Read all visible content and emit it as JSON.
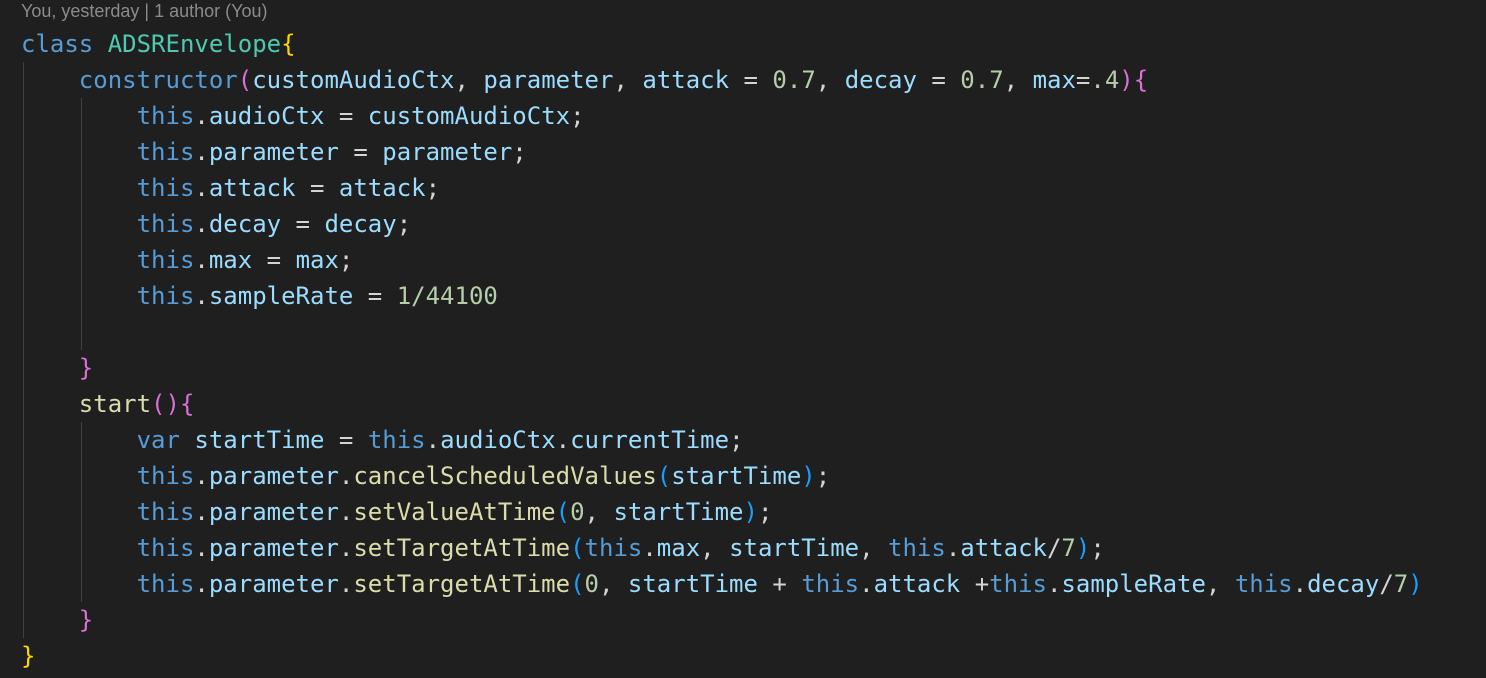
{
  "blame": {
    "text": "You, yesterday | 1 author (You)"
  },
  "lines": [
    {
      "indent": 0,
      "tokens": [
        {
          "t": "class",
          "c": "kw"
        },
        {
          "t": " ",
          "c": "op"
        },
        {
          "t": "ADSREnvelope",
          "c": "cls"
        },
        {
          "t": "{",
          "c": "b1"
        }
      ]
    },
    {
      "indent": 1,
      "tokens": [
        {
          "t": "constructor",
          "c": "kw"
        },
        {
          "t": "(",
          "c": "b2"
        },
        {
          "t": "customAudioCtx",
          "c": "prm"
        },
        {
          "t": ", ",
          "c": "op"
        },
        {
          "t": "parameter",
          "c": "prm"
        },
        {
          "t": ", ",
          "c": "op"
        },
        {
          "t": "attack",
          "c": "prm"
        },
        {
          "t": " = ",
          "c": "op"
        },
        {
          "t": "0.7",
          "c": "num"
        },
        {
          "t": ", ",
          "c": "op"
        },
        {
          "t": "decay",
          "c": "prm"
        },
        {
          "t": " = ",
          "c": "op"
        },
        {
          "t": "0.7",
          "c": "num"
        },
        {
          "t": ", ",
          "c": "op"
        },
        {
          "t": "max",
          "c": "prm"
        },
        {
          "t": "=",
          "c": "op"
        },
        {
          "t": ".4",
          "c": "num"
        },
        {
          "t": ")",
          "c": "b2"
        },
        {
          "t": "{",
          "c": "b2"
        }
      ]
    },
    {
      "indent": 2,
      "tokens": [
        {
          "t": "this",
          "c": "kw"
        },
        {
          "t": ".",
          "c": "op"
        },
        {
          "t": "audioCtx",
          "c": "prm"
        },
        {
          "t": " = ",
          "c": "op"
        },
        {
          "t": "customAudioCtx",
          "c": "prm"
        },
        {
          "t": ";",
          "c": "op"
        }
      ]
    },
    {
      "indent": 2,
      "tokens": [
        {
          "t": "this",
          "c": "kw"
        },
        {
          "t": ".",
          "c": "op"
        },
        {
          "t": "parameter",
          "c": "prm"
        },
        {
          "t": " = ",
          "c": "op"
        },
        {
          "t": "parameter",
          "c": "prm"
        },
        {
          "t": ";",
          "c": "op"
        }
      ]
    },
    {
      "indent": 2,
      "tokens": [
        {
          "t": "this",
          "c": "kw"
        },
        {
          "t": ".",
          "c": "op"
        },
        {
          "t": "attack",
          "c": "prm"
        },
        {
          "t": " = ",
          "c": "op"
        },
        {
          "t": "attack",
          "c": "prm"
        },
        {
          "t": ";",
          "c": "op"
        }
      ]
    },
    {
      "indent": 2,
      "tokens": [
        {
          "t": "this",
          "c": "kw"
        },
        {
          "t": ".",
          "c": "op"
        },
        {
          "t": "decay",
          "c": "prm"
        },
        {
          "t": " = ",
          "c": "op"
        },
        {
          "t": "decay",
          "c": "prm"
        },
        {
          "t": ";",
          "c": "op"
        }
      ]
    },
    {
      "indent": 2,
      "tokens": [
        {
          "t": "this",
          "c": "kw"
        },
        {
          "t": ".",
          "c": "op"
        },
        {
          "t": "max",
          "c": "prm"
        },
        {
          "t": " = ",
          "c": "op"
        },
        {
          "t": "max",
          "c": "prm"
        },
        {
          "t": ";",
          "c": "op"
        }
      ]
    },
    {
      "indent": 2,
      "tokens": [
        {
          "t": "this",
          "c": "kw"
        },
        {
          "t": ".",
          "c": "op"
        },
        {
          "t": "sampleRate",
          "c": "prm"
        },
        {
          "t": " = ",
          "c": "op"
        },
        {
          "t": "1/44100",
          "c": "num"
        }
      ]
    },
    {
      "indent": 0,
      "tokens": []
    },
    {
      "indent": 1,
      "tokens": [
        {
          "t": "}",
          "c": "b2"
        }
      ]
    },
    {
      "indent": 1,
      "tokens": [
        {
          "t": "start",
          "c": "fn"
        },
        {
          "t": "()",
          "c": "b2"
        },
        {
          "t": "{",
          "c": "b2"
        }
      ]
    },
    {
      "indent": 2,
      "tokens": [
        {
          "t": "var",
          "c": "kw"
        },
        {
          "t": " ",
          "c": "op"
        },
        {
          "t": "startTime",
          "c": "prm"
        },
        {
          "t": " = ",
          "c": "op"
        },
        {
          "t": "this",
          "c": "kw"
        },
        {
          "t": ".",
          "c": "op"
        },
        {
          "t": "audioCtx",
          "c": "prm"
        },
        {
          "t": ".",
          "c": "op"
        },
        {
          "t": "currentTime",
          "c": "prm"
        },
        {
          "t": ";",
          "c": "op"
        }
      ]
    },
    {
      "indent": 2,
      "tokens": [
        {
          "t": "this",
          "c": "kw"
        },
        {
          "t": ".",
          "c": "op"
        },
        {
          "t": "parameter",
          "c": "prm"
        },
        {
          "t": ".",
          "c": "op"
        },
        {
          "t": "cancelScheduledValues",
          "c": "fn"
        },
        {
          "t": "(",
          "c": "b3"
        },
        {
          "t": "startTime",
          "c": "prm"
        },
        {
          "t": ")",
          "c": "b3"
        },
        {
          "t": ";",
          "c": "op"
        }
      ]
    },
    {
      "indent": 2,
      "tokens": [
        {
          "t": "this",
          "c": "kw"
        },
        {
          "t": ".",
          "c": "op"
        },
        {
          "t": "parameter",
          "c": "prm"
        },
        {
          "t": ".",
          "c": "op"
        },
        {
          "t": "setValueAtTime",
          "c": "fn"
        },
        {
          "t": "(",
          "c": "b3"
        },
        {
          "t": "0",
          "c": "num"
        },
        {
          "t": ", ",
          "c": "op"
        },
        {
          "t": "startTime",
          "c": "prm"
        },
        {
          "t": ")",
          "c": "b3"
        },
        {
          "t": ";",
          "c": "op"
        }
      ]
    },
    {
      "indent": 2,
      "tokens": [
        {
          "t": "this",
          "c": "kw"
        },
        {
          "t": ".",
          "c": "op"
        },
        {
          "t": "parameter",
          "c": "prm"
        },
        {
          "t": ".",
          "c": "op"
        },
        {
          "t": "setTargetAtTime",
          "c": "fn"
        },
        {
          "t": "(",
          "c": "b3"
        },
        {
          "t": "this",
          "c": "kw"
        },
        {
          "t": ".",
          "c": "op"
        },
        {
          "t": "max",
          "c": "prm"
        },
        {
          "t": ", ",
          "c": "op"
        },
        {
          "t": "startTime",
          "c": "prm"
        },
        {
          "t": ", ",
          "c": "op"
        },
        {
          "t": "this",
          "c": "kw"
        },
        {
          "t": ".",
          "c": "op"
        },
        {
          "t": "attack",
          "c": "prm"
        },
        {
          "t": "/",
          "c": "op"
        },
        {
          "t": "7",
          "c": "num"
        },
        {
          "t": ")",
          "c": "b3"
        },
        {
          "t": ";",
          "c": "op"
        }
      ]
    },
    {
      "indent": 2,
      "tokens": [
        {
          "t": "this",
          "c": "kw"
        },
        {
          "t": ".",
          "c": "op"
        },
        {
          "t": "parameter",
          "c": "prm"
        },
        {
          "t": ".",
          "c": "op"
        },
        {
          "t": "setTargetAtTime",
          "c": "fn"
        },
        {
          "t": "(",
          "c": "b3"
        },
        {
          "t": "0",
          "c": "num"
        },
        {
          "t": ", ",
          "c": "op"
        },
        {
          "t": "startTime",
          "c": "prm"
        },
        {
          "t": " + ",
          "c": "op"
        },
        {
          "t": "this",
          "c": "kw"
        },
        {
          "t": ".",
          "c": "op"
        },
        {
          "t": "attack",
          "c": "prm"
        },
        {
          "t": " +",
          "c": "op"
        },
        {
          "t": "this",
          "c": "kw"
        },
        {
          "t": ".",
          "c": "op"
        },
        {
          "t": "sampleRate",
          "c": "prm"
        },
        {
          "t": ", ",
          "c": "op"
        },
        {
          "t": "this",
          "c": "kw"
        },
        {
          "t": ".",
          "c": "op"
        },
        {
          "t": "decay",
          "c": "prm"
        },
        {
          "t": "/",
          "c": "op"
        },
        {
          "t": "7",
          "c": "num"
        },
        {
          "t": ")",
          "c": "b3"
        }
      ]
    },
    {
      "indent": 1,
      "tokens": [
        {
          "t": "}",
          "c": "b2"
        }
      ]
    },
    {
      "indent": 0,
      "tokens": [
        {
          "t": "}",
          "c": "b1"
        }
      ]
    }
  ]
}
